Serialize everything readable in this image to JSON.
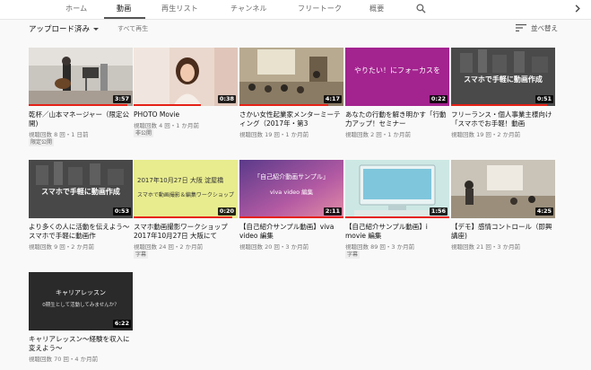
{
  "tabs": [
    "ホーム",
    "動画",
    "再生リスト",
    "チャンネル",
    "フリートーク",
    "概要"
  ],
  "toolbar": {
    "uploads_label": "アップロード済み",
    "play_all": "すべて再生",
    "sort_label": "並べ替え"
  },
  "colors": {
    "accent": "#e62117",
    "tab_bar": "#ffffff",
    "background": "#f9f9f9"
  },
  "videos": [
    {
      "title": "乾杯／山本マネージャー（限定公開)",
      "meta": "視聴回数 8 回・1 日前",
      "duration": "3:57",
      "badge": "限定公開",
      "progress": 0.95
    },
    {
      "title": "PHOTO Movie",
      "meta": "視聴回数 4 回・1 か月前",
      "duration": "0:38",
      "badge": "非公開",
      "progress": 0.65
    },
    {
      "title": "さかい女性起業家メンターミーティング（2017年・第3",
      "meta": "視聴回数 19 回・1 か月前",
      "duration": "4:17",
      "badge": "",
      "progress": 0.85
    },
    {
      "title": "あなたの行動を解き明かす「行動力アップ！セミナー",
      "meta": "視聴回数 2 回・1 か月前",
      "duration": "0:22",
      "badge": "",
      "progress": 0
    },
    {
      "title": "フリーランス・個人事業主様向け「スマホでお手軽！動画",
      "meta": "視聴回数 19 回・2 か月前",
      "duration": "0:51",
      "badge": "",
      "progress": 0.92
    },
    {
      "title": "より多くの人に活動を伝えよう〜スマホで手軽に動画作",
      "meta": "視聴回数 9 回・2 か月前",
      "duration": "0:53",
      "badge": "",
      "progress": 0
    },
    {
      "title": "スマホ動画撮影ワークショップ 2017年10月27日 大阪にて",
      "meta": "視聴回数 24 回・2 か月前",
      "duration": "0:20",
      "badge": "字幕",
      "progress": 0.95
    },
    {
      "title": "【自己紹介サンプル動画】viva video 編集",
      "meta": "視聴回数 20 回・3 か月前",
      "duration": "2:11",
      "badge": "",
      "progress": 1.0
    },
    {
      "title": "【自己紹介サンプル動画】i movie 編集",
      "meta": "視聴回数 89 回・3 か月前",
      "duration": "1:56",
      "badge": "字幕",
      "progress": 1.0
    },
    {
      "title": "【デモ】感情コントロール（即興講座)",
      "meta": "視聴回数 21 回・3 か月前",
      "duration": "4:25",
      "badge": "",
      "progress": 0
    },
    {
      "title": "キャリアレッスン〜経験を収入に変えよう〜",
      "meta": "視聴回数 70 回・4 か月前",
      "duration": "6:22",
      "badge": "",
      "progress": 0
    }
  ],
  "thumb_text": {
    "t4": "やりたい！にフォーカスを",
    "t5": "スマホで手軽に動画作成",
    "t6": "スマホで手軽に動画作成",
    "t7a": "2017年10月27日 大阪 淀屋橋",
    "t7b": "スマホで動画撮影＆編集ワークショップ",
    "t8a": "「自己紹介動画サンプル」",
    "t8b": "viva video 編集",
    "t11a": "キャリアレッスン",
    "t11b": "0期生として活動してみませんか？"
  }
}
